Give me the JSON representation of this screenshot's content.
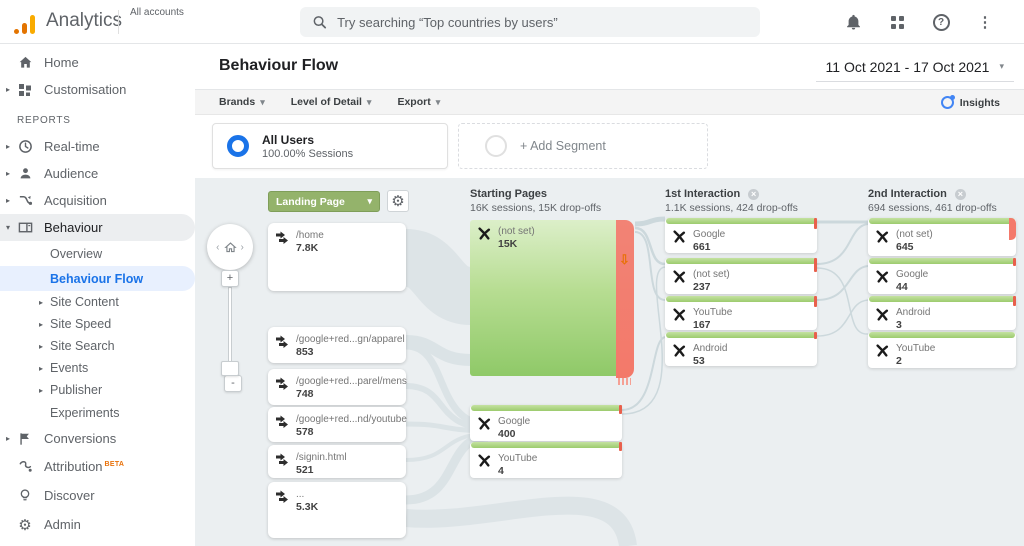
{
  "topbar": {
    "brand": "Analytics",
    "accounts": "All accounts",
    "search_placeholder": "Try searching “Top countries by users”"
  },
  "sidebar": {
    "home": "Home",
    "customisation": "Customisation",
    "reports": "REPORTS",
    "realtime": "Real-time",
    "audience": "Audience",
    "acquisition": "Acquisition",
    "behaviour": "Behaviour",
    "overview": "Overview",
    "behaviour_flow": "Behaviour Flow",
    "site_content": "Site Content",
    "site_speed": "Site Speed",
    "site_search": "Site Search",
    "events": "Events",
    "publisher": "Publisher",
    "experiments": "Experiments",
    "conversions": "Conversions",
    "attribution": "Attribution",
    "beta": "BETA",
    "discover": "Discover",
    "admin": "Admin"
  },
  "header": {
    "title": "Behaviour Flow",
    "date_range": "11 Oct 2021 - 17 Oct 2021"
  },
  "toolbar": {
    "brands": "Brands",
    "level_of_detail": "Level of Detail",
    "export": "Export",
    "insights": "Insights"
  },
  "segments": {
    "all_users_label": "All Users",
    "all_users_detail": "100.00% Sessions",
    "add_segment": "+ Add Segment"
  },
  "flow": {
    "dimension_selector": "Landing Page",
    "columns": [
      {
        "title": "Starting Pages",
        "subtitle": "16K sessions, 15K drop-offs"
      },
      {
        "title": "1st Interaction",
        "subtitle": "1.1K sessions, 424 drop-offs"
      },
      {
        "title": "2nd Interaction",
        "subtitle": "694 sessions, 461 drop-offs"
      }
    ],
    "landing_nodes": [
      {
        "label": "/home",
        "value": "7.8K"
      },
      {
        "label": "/google+red...gn/apparel",
        "value": "853"
      },
      {
        "label": "/google+red...parel/mens",
        "value": "748"
      },
      {
        "label": "/google+red...nd/youtube",
        "value": "578"
      },
      {
        "label": "/signin.html",
        "value": "521"
      },
      {
        "label": "...",
        "value": "5.3K"
      }
    ],
    "starting_nodes": [
      {
        "label": "(not set)",
        "value": "15K"
      },
      {
        "label": "Google",
        "value": "400"
      },
      {
        "label": "YouTube",
        "value": "4"
      }
    ],
    "first_nodes": [
      {
        "label": "Google",
        "value": "661"
      },
      {
        "label": "(not set)",
        "value": "237"
      },
      {
        "label": "YouTube",
        "value": "167"
      },
      {
        "label": "Android",
        "value": "53"
      }
    ],
    "second_nodes": [
      {
        "label": "(not set)",
        "value": "645"
      },
      {
        "label": "Google",
        "value": "44"
      },
      {
        "label": "Android",
        "value": "3"
      },
      {
        "label": "YouTube",
        "value": "2"
      }
    ]
  }
}
